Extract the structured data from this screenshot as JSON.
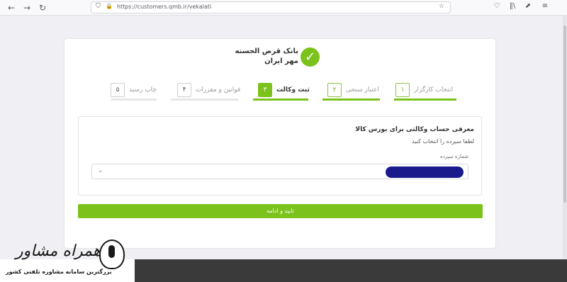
{
  "browser": {
    "url": "https://customers.qmb.ir/vekalati",
    "back_icon": "←",
    "forward_icon": "→",
    "reload_icon": "↻",
    "shield_icon": "⛉",
    "lock_icon": "🔒",
    "star_icon": "☆",
    "pocket_icon": "♡",
    "library_icon": "‖\\",
    "extensions_icon": "⬈",
    "menu_icon": "≡"
  },
  "logo": {
    "line1": "بانک قرض الحسنه",
    "line2": "مهر ایران",
    "mark": "✓"
  },
  "steps": [
    {
      "num": "۱",
      "label": "انتخاب کارگزار",
      "state": "done"
    },
    {
      "num": "۲",
      "label": "اعتبار سنجی",
      "state": "done"
    },
    {
      "num": "۳",
      "label": "ثبت وکالت",
      "state": "active"
    },
    {
      "num": "۴",
      "label": "قوانین و مقررات",
      "state": "todo"
    },
    {
      "num": "۵",
      "label": "چاپ رسید",
      "state": "todo"
    }
  ],
  "form": {
    "title": "معرفی حساب وکالتی برای بورس کالا",
    "subtitle": "لطفا سپرده را انتخاب کنید",
    "field_label": "شماره سپرده",
    "selected_value": "",
    "chevron": "⌄"
  },
  "submit_label": "تایید و ادامه",
  "watermark": {
    "title": "همراه مشاور",
    "subtitle": "بزرگترین سامانه مشاوره تلفنی کشور"
  },
  "colors": {
    "accent": "#7cc21c",
    "redaction": "#1a1a8c"
  }
}
